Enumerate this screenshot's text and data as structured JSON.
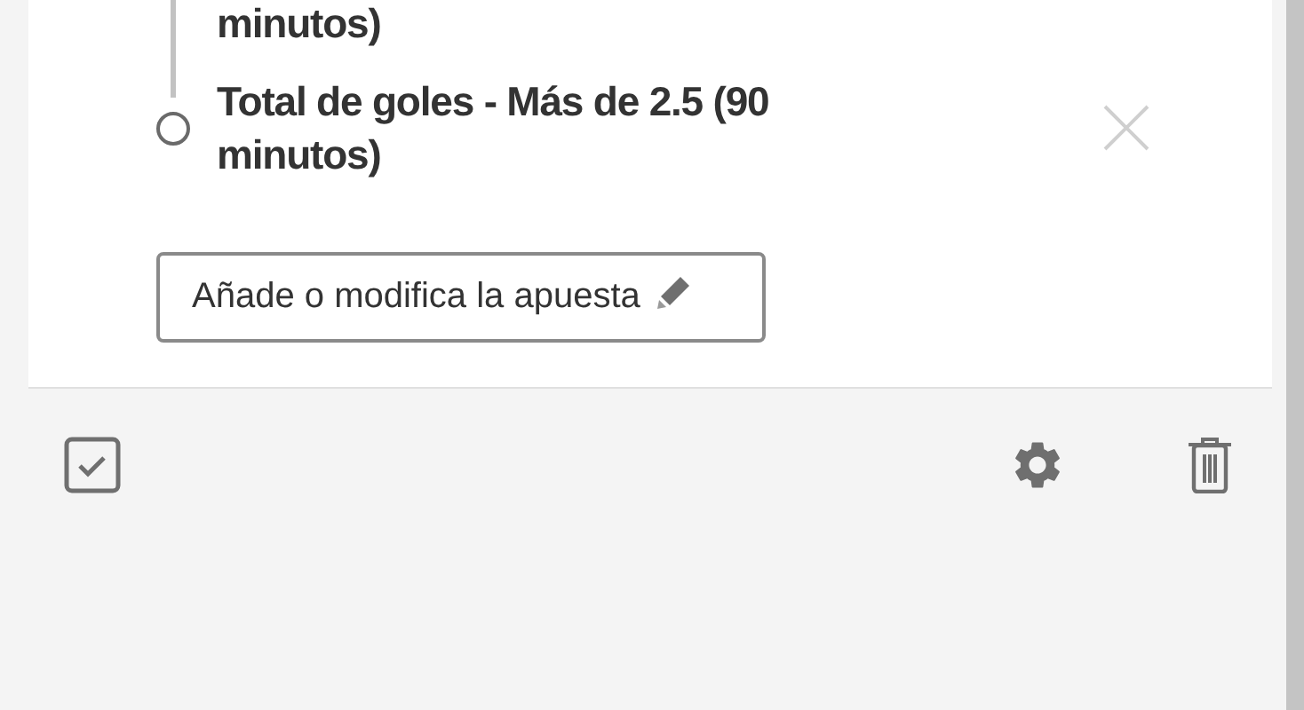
{
  "selections": [
    {
      "kind": "partial",
      "text": "minutos)"
    },
    {
      "kind": "full",
      "text": "Total de goles - Más de 2.5 (90 minutos)"
    }
  ],
  "edit_button": {
    "label": "Añade o modifica la apuesta"
  }
}
